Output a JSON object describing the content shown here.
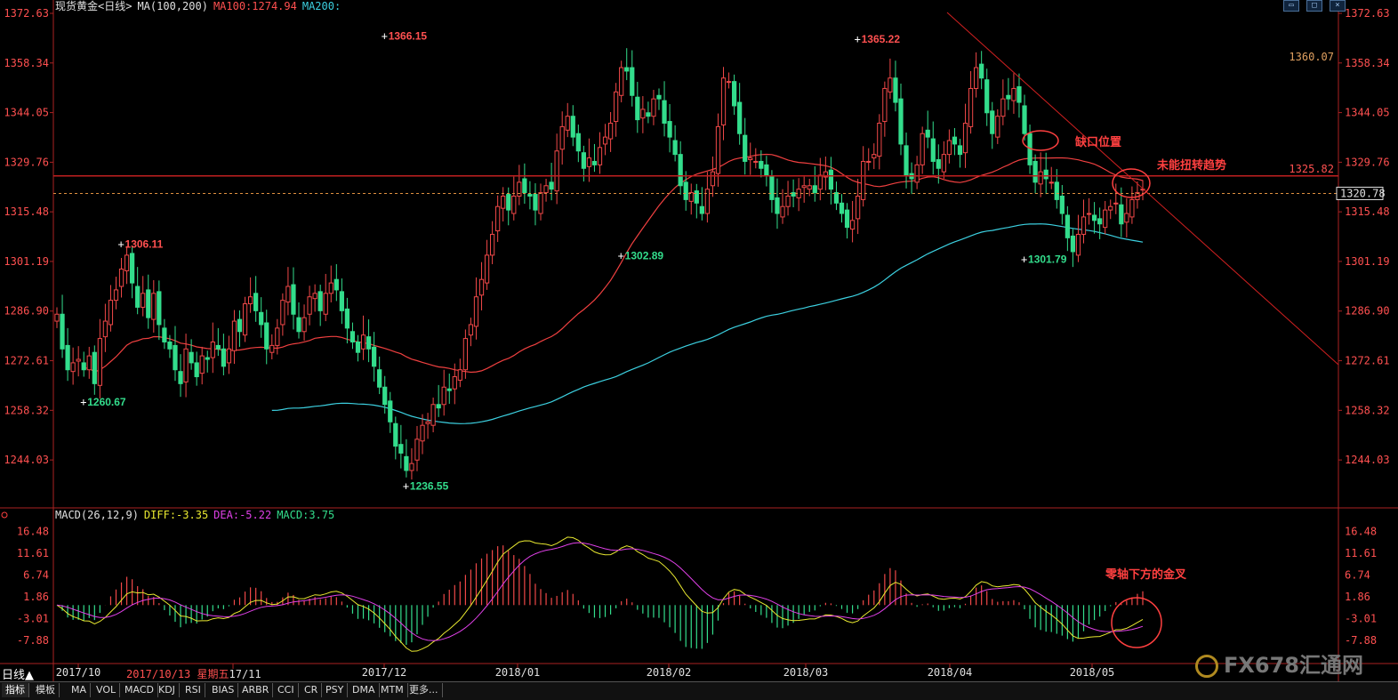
{
  "header": {
    "title": "现货黄金<日线>",
    "ma_label": "MA(100,200)",
    "ma100_label": "MA100:1274.94",
    "ma200_label": "MA200:"
  },
  "macd_header": {
    "label": "MACD(26,12,9)",
    "diff": "DIFF:-3.35",
    "dea": "DEA:-5.22",
    "macd": "MACD:3.75"
  },
  "bottom_left": {
    "period": "日线",
    "date": "2017/10/13",
    "weekday": "星期五",
    "extra": "17/11"
  },
  "tabs": [
    "指标",
    "模板",
    "MA",
    "VOL",
    "MACD",
    "KDJ",
    "RSI",
    "BIAS",
    "ARBR",
    "CCI",
    "CR",
    "PSY",
    "DMA",
    "MTM",
    "更多..."
  ],
  "watermark": "FX678汇通网",
  "colors": {
    "up": "#f04848",
    "down": "#33dd8c",
    "ma100": "#f04040",
    "ma200": "#3cd0e0",
    "diff": "#e8e830",
    "dea": "#e040e8",
    "annotation": "#ff4040",
    "axis_label": "#ff5050",
    "neutral_label": "#e0a060"
  },
  "chart_data": {
    "type": "candlestick",
    "title": "现货黄金<日线>",
    "price_axis": {
      "ticks": [
        1372.63,
        1358.34,
        1344.05,
        1329.76,
        1315.48,
        1301.19,
        1286.9,
        1272.61,
        1258.32,
        1244.03
      ],
      "range": [
        1231,
        1372.63
      ]
    },
    "x_labels": [
      "2017/10",
      "2017/11",
      "2017/12",
      "2018/01",
      "2018/02",
      "2018/03",
      "2018/04",
      "2018/05"
    ],
    "x_label_text": {
      "2017/10": "2017/10",
      "2017/12": "2017/12",
      "2018/01": "2018/01",
      "2018/02": "2018/02",
      "2018/03": "2018/03",
      "2018/04": "2018/04",
      "2018/05": "2018/05"
    },
    "candle_close": [
      1286,
      1276,
      1270,
      1272,
      1273,
      1270,
      1274,
      1266,
      1279,
      1284,
      1290,
      1293,
      1299,
      1303,
      1295,
      1288,
      1292,
      1285,
      1292,
      1283,
      1278,
      1276,
      1270,
      1266,
      1276,
      1272,
      1268,
      1274,
      1273,
      1278,
      1276,
      1271,
      1276,
      1284,
      1281,
      1289,
      1291,
      1287,
      1283,
      1276,
      1277,
      1282,
      1290,
      1294,
      1286,
      1281,
      1285,
      1291,
      1292,
      1287,
      1292,
      1295,
      1293,
      1287,
      1282,
      1278,
      1275,
      1280,
      1276,
      1271,
      1265,
      1260,
      1255,
      1248,
      1246,
      1241,
      1243,
      1250,
      1254,
      1255,
      1260,
      1259,
      1265,
      1264,
      1268,
      1270,
      1279,
      1283,
      1291,
      1296,
      1303,
      1309,
      1317,
      1320,
      1316,
      1320,
      1324,
      1321,
      1320,
      1316,
      1321,
      1323,
      1322,
      1333,
      1340,
      1343,
      1337,
      1333,
      1328,
      1331,
      1329,
      1334,
      1337,
      1341,
      1350,
      1357,
      1356,
      1349,
      1342,
      1345,
      1343,
      1348,
      1348,
      1341,
      1337,
      1332,
      1323,
      1319,
      1321,
      1318,
      1315,
      1322,
      1327,
      1340,
      1354,
      1353,
      1346,
      1338,
      1330,
      1331,
      1330,
      1328,
      1326,
      1319,
      1315,
      1317,
      1320,
      1320,
      1322,
      1323,
      1323,
      1321,
      1326,
      1327,
      1322,
      1318,
      1315,
      1311,
      1313,
      1320,
      1330,
      1330,
      1332,
      1341,
      1351,
      1354,
      1347,
      1335,
      1326,
      1325,
      1329,
      1338,
      1337,
      1330,
      1328,
      1332,
      1336,
      1335,
      1332,
      1341,
      1351,
      1357,
      1354,
      1344,
      1338,
      1343,
      1348,
      1348,
      1351,
      1347,
      1338,
      1329,
      1324,
      1327,
      1325,
      1324,
      1319,
      1315,
      1308,
      1304,
      1309,
      1314,
      1315,
      1313,
      1312,
      1316,
      1317,
      1318,
      1312,
      1315,
      1319,
      1321,
      1322
    ],
    "candles_count": 200,
    "extreme_labels": [
      {
        "text": "1366.15",
        "value": 1366.15
      },
      {
        "text": "1365.22",
        "value": 1365.22
      },
      {
        "text": "1306.11",
        "value": 1306.11
      },
      {
        "text": "1302.89",
        "value": 1302.89
      },
      {
        "text": "1301.79",
        "value": 1301.79
      },
      {
        "text": "1260.67",
        "value": 1260.67
      },
      {
        "text": "1236.55",
        "value": 1236.55
      }
    ],
    "right_labels": [
      {
        "text": "1360.07",
        "value": 1360.07
      },
      {
        "text": "1325.82",
        "value": 1325.82
      },
      {
        "text": "1320.78",
        "value": 1320.78
      }
    ],
    "hline_level": 1325.82,
    "current_level": 1320.78,
    "annotations": [
      {
        "text": "缺口位置"
      },
      {
        "text": "未能扭转趋势"
      },
      {
        "text": "零轴下方的金叉"
      }
    ],
    "macd_axis": {
      "ticks": [
        16.48,
        11.61,
        6.74,
        1.86,
        -3.01,
        -7.88
      ],
      "range": [
        -11.5,
        18.0
      ]
    },
    "macd_current": {
      "diff": -3.35,
      "dea": -5.22,
      "macd": 3.75
    }
  }
}
